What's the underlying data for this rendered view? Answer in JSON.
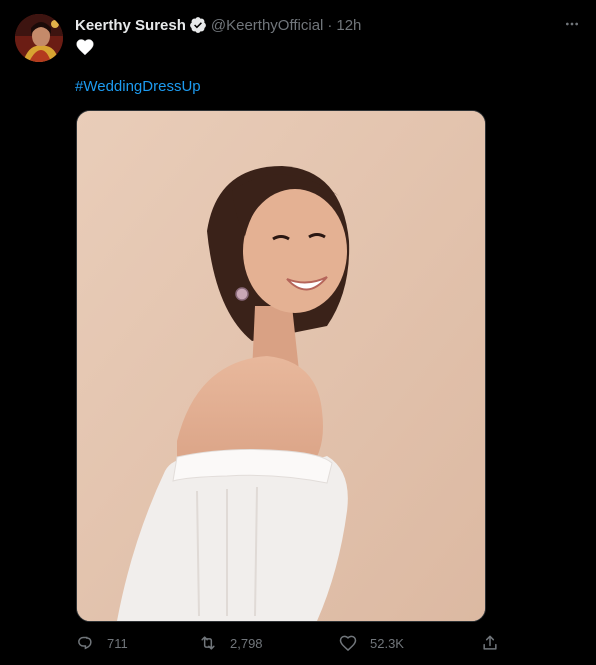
{
  "tweet": {
    "author": {
      "display_name": "Keerthy Suresh",
      "verified": true,
      "handle": "@KeerthyOfficial",
      "time": "12h"
    },
    "text": {
      "emoji": "white-heart",
      "hashtag": "#WeddingDressUp"
    },
    "actions": {
      "replies": "711",
      "retweets": "2,798",
      "likes": "52.3K"
    }
  },
  "icons": {
    "more": "more-horizontal-icon",
    "reply": "reply-icon",
    "retweet": "retweet-icon",
    "like": "heart-icon",
    "share": "share-icon",
    "verified": "verified-badge-icon"
  },
  "colors": {
    "background": "#000000",
    "text_primary": "#e7e9ea",
    "text_secondary": "#71767b",
    "link": "#1d9bf0",
    "photo_backdrop": "#e4c6b2"
  }
}
